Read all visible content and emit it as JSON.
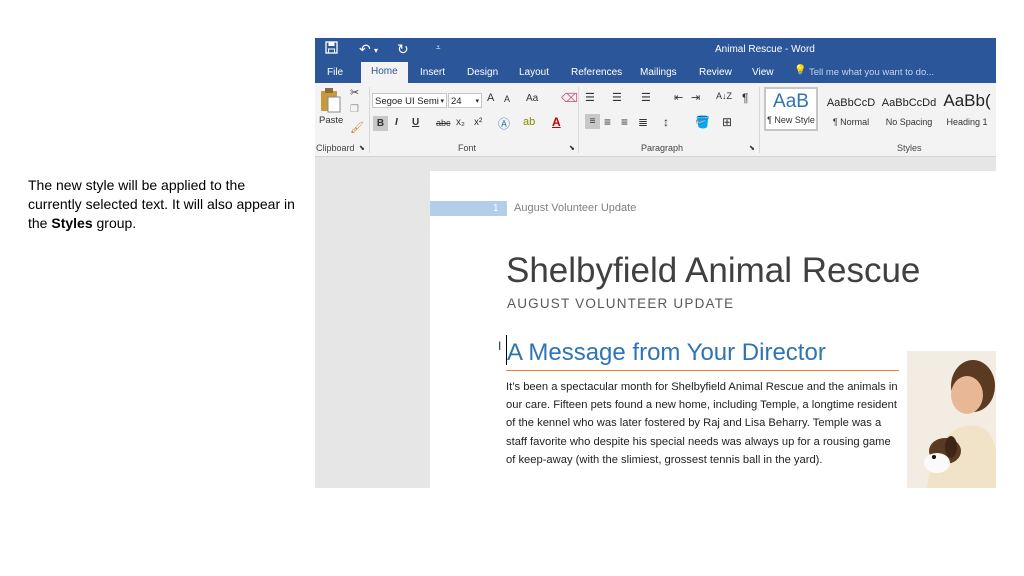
{
  "caption": {
    "before": "The new style will be applied to the currently selected text. It will also appear in the ",
    "bold": "Styles",
    "after": " group."
  },
  "window": {
    "title": "Animal Rescue - Word"
  },
  "quick_access": {
    "save_icon": "save-icon",
    "undo_icon": "undo-icon",
    "redo_icon": "redo-icon",
    "customize_icon": "customize-icon"
  },
  "tabs": [
    "File",
    "Home",
    "Insert",
    "Design",
    "Layout",
    "References",
    "Mailings",
    "Review",
    "View"
  ],
  "tell_me": "Tell me what you want to do...",
  "ribbon": {
    "clipboard": {
      "label": "Clipboard",
      "paste": "Paste"
    },
    "font": {
      "label": "Font",
      "name": "Segoe UI Semi",
      "size": "24",
      "bold": "B",
      "italic": "I",
      "underline": "U",
      "strike": "abc",
      "sub": "x₂",
      "sup": "x²",
      "grow": "A",
      "shrink": "A",
      "case": "Aa",
      "color_letter": "A"
    },
    "paragraph": {
      "label": "Paragraph",
      "sort": "A↓Z",
      "pilcrow": "¶"
    },
    "styles": {
      "label": "Styles",
      "items": [
        {
          "preview": "AaB",
          "name": "¶ New Style"
        },
        {
          "preview": "AaBbCcD",
          "name": "¶ Normal"
        },
        {
          "preview": "AaBbCcDd",
          "name": "No Spacing"
        },
        {
          "preview": "AaBb(",
          "name": "Heading 1"
        }
      ]
    }
  },
  "document": {
    "page_number": "1",
    "header": "August Volunteer Update",
    "title": "Shelbyfield Animal Rescue",
    "subtitle": "AUGUST VOLUNTEER UPDATE",
    "heading": "A Message from Your Director",
    "body": "It’s been a spectacular month for Shelbyfield Animal Rescue and the animals in our care. Fifteen pets found a new home, including Temple, a longtime resident of the kennel who was later fostered by Raj and Lisa Beharry. Temple was a staff favorite who despite his special needs was always up for a rousing game of keep-away (with the slimiest, grossest tennis ball in the yard)."
  },
  "colors": {
    "word_blue": "#2b579a",
    "heading_blue": "#2e74b5",
    "heading_rule": "#ed7d31"
  }
}
